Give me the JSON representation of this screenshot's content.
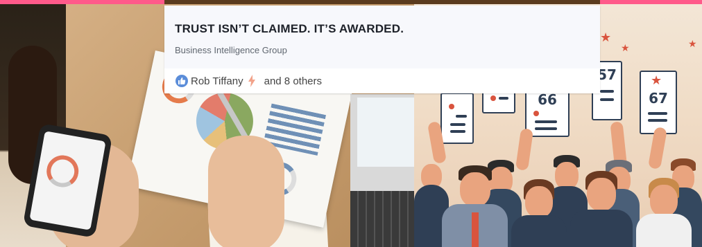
{
  "card": {
    "title": "TRUST ISN’T CLAIMED. IT’S AWARDED.",
    "subtitle": "Business Intelligence Group"
  },
  "reactions": {
    "name": "Rob Tiffany",
    "others": "and 8 others",
    "reaction_icon": "like-icon",
    "secondary_icon": "lightning-icon"
  },
  "illustration": {
    "signs": [
      "66",
      "57",
      "67"
    ]
  },
  "colors": {
    "accent_pink": "#ff5a8a",
    "like_blue": "#5b8dd9",
    "card_bg": "#f7f8fc"
  }
}
